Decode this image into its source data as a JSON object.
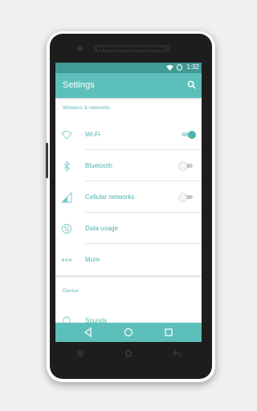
{
  "statusbar": {
    "time": "1:32",
    "wifi_icon": "wifi-icon",
    "battery_icon": "battery-icon"
  },
  "appbar": {
    "title": "Settings",
    "search_icon": "search-icon"
  },
  "sections": {
    "wireless": "Wireless & networks",
    "device": "Device"
  },
  "items": [
    {
      "label": "Wi-Fi",
      "icon": "wifi-icon",
      "toggle": true,
      "toggle_on": true
    },
    {
      "label": "Bluetooth",
      "icon": "bluetooth-icon",
      "toggle": true,
      "toggle_on": false
    },
    {
      "label": "Cellular networks",
      "icon": "signal-icon",
      "toggle": true,
      "toggle_on": false
    },
    {
      "label": "Data usage",
      "icon": "data-usage-icon",
      "toggle": false
    },
    {
      "label": "More",
      "icon": "more-icon",
      "toggle": false
    },
    {
      "label": "Sounds",
      "icon": "bell-icon",
      "toggle": false
    }
  ],
  "navbar": {
    "back_icon": "back-icon",
    "home_icon": "home-icon",
    "recents_icon": "recents-icon"
  },
  "hardware_keys": {
    "menu_icon": "menu-icon",
    "home_icon": "home-icon",
    "back_icon": "back-icon"
  },
  "colors": {
    "accent": "#5dbfb9",
    "status": "#429a96",
    "text_accent": "#4fb3ad"
  }
}
